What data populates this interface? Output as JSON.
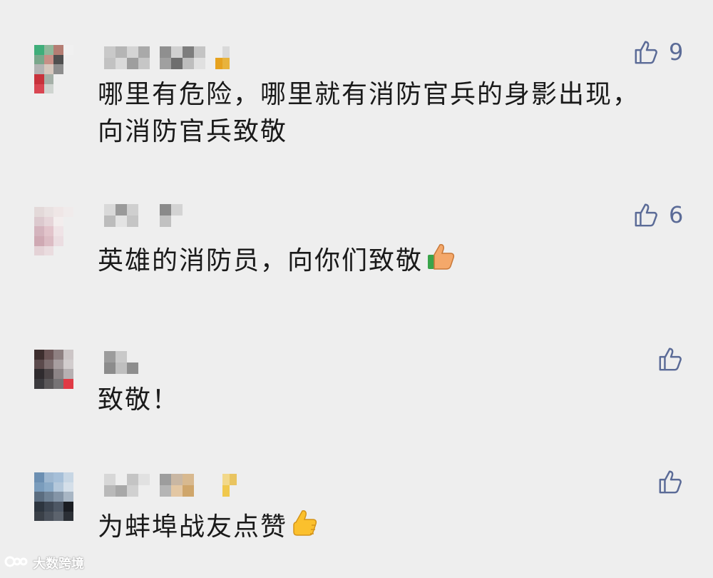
{
  "comments": [
    {
      "text_line1": "哪里有危险，哪里就有消防官兵的身影出现，",
      "text_line2": "向消防官兵致敬",
      "likes": "9",
      "avatar_colors": [
        "#3fae7a",
        "#8fb79a",
        "#b47d73",
        "#f0f0f0",
        "#eeeeee",
        "#eeeeee",
        "#7aa78b",
        "#c88f86",
        "#4f4f4f",
        "#eeeeee",
        "#eeeeee",
        "#eeeeee",
        "#b3b3b3",
        "#d6c7bd",
        "#8d8d8d",
        "#eeeeee",
        "#eeeeee",
        "#eeeeee",
        "#c8323b",
        "#a5b0a8",
        "#eeeeee",
        "#eeeeee",
        "#eeeeee",
        "#eeeeee",
        "#d94652",
        "#cfd4d0",
        "#eeeeee",
        "#eeeeee",
        "#eeeeee",
        "#eeeeee",
        "#eeeeee",
        "#eeeeee",
        "#eeeeee",
        "#eeeeee",
        "#eeeeee",
        "#eeeeee"
      ],
      "nick_colors": [
        "#c9c9c9",
        "#b5b5b5",
        "#d4d4d4",
        "#a9a9a9",
        "#c2c2c2",
        "#dadada",
        "#9e9e9e",
        "#c6c6c6"
      ],
      "nick_colors2": [
        "#8f8f8f",
        "#d0d0d0",
        "#7d7d7d",
        "#c4c4c4",
        "#a0a0a0",
        "#6e6e6e",
        "#bdbdbd",
        "#e0e0e0"
      ],
      "nick_colors3": [
        "#eeeeee",
        "#d9d9d9",
        "#eeeeee",
        "#eeeeee",
        "#e6a21f",
        "#e8b33c",
        "#eeeeee",
        "#eeeeee"
      ]
    },
    {
      "text": "英雄的消防员，向你们致敬",
      "likes": "6",
      "avatar_colors": [
        "#e3d9d9",
        "#e9e1e1",
        "#efe6e6",
        "#f0ebeb",
        "#eeeeee",
        "#eeeeee",
        "#dcc9ce",
        "#e6d5d9",
        "#f3eded",
        "#eeeeee",
        "#eeeeee",
        "#eeeeee",
        "#d4b4bd",
        "#e2c4cb",
        "#efe3e6",
        "#eeeeee",
        "#eeeeee",
        "#eeeeee",
        "#cfa9b3",
        "#dcbcc4",
        "#ebdde1",
        "#eeeeee",
        "#eeeeee",
        "#eeeeee",
        "#e4d2d6",
        "#eadcdf",
        "#eeeeee",
        "#eeeeee",
        "#eeeeee",
        "#eeeeee",
        "#eeeeee",
        "#eeeeee",
        "#eeeeee",
        "#eeeeee",
        "#eeeeee",
        "#eeeeee"
      ],
      "nick_colors": [
        "#d9d9d9",
        "#9a9a9a",
        "#cfcfcf",
        "#eeeeee",
        "#bcbcbc",
        "#e3e3e3",
        "#c5c5c5",
        "#eeeeee"
      ],
      "nick_colors2": [
        "#8a8a8a",
        "#d3d3d3",
        "#eeeeee",
        "#eeeeee",
        "#c1c1c1",
        "#eeeeee",
        "#eeeeee",
        "#eeeeee"
      ]
    },
    {
      "text": "致敬！",
      "avatar_colors": [
        "#3d2e2e",
        "#6b5556",
        "#8e8081",
        "#ccc5c6",
        "#eeeeee",
        "#eeeeee",
        "#5b4a4c",
        "#7d6e70",
        "#a79ea0",
        "#d2cdce",
        "#eeeeee",
        "#eeeeee",
        "#2f2b2e",
        "#4c4547",
        "#8c8486",
        "#b6b0b2",
        "#eeeeee",
        "#eeeeee",
        "#3b3a3e",
        "#5a5759",
        "#767375",
        "#e03a45",
        "#eeeeee",
        "#eeeeee",
        "#eeeeee",
        "#eeeeee",
        "#eeeeee",
        "#eeeeee",
        "#eeeeee",
        "#eeeeee",
        "#eeeeee",
        "#eeeeee",
        "#eeeeee",
        "#eeeeee",
        "#eeeeee",
        "#eeeeee"
      ],
      "nick_colors": [
        "#9c9c9c",
        "#c9c9c9",
        "#eeeeee",
        "#eeeeee",
        "#8c8c8c",
        "#bfbfbf",
        "#8e8e8e",
        "#eeeeee"
      ]
    },
    {
      "text": "为蚌埠战友点赞",
      "avatar_colors": [
        "#6c8fb2",
        "#9eb7d0",
        "#a6bfd8",
        "#c7d6e4",
        "#eeeeee",
        "#eeeeee",
        "#7a9cbc",
        "#8aaac7",
        "#b4c8db",
        "#d4dfe9",
        "#eeeeee",
        "#eeeeee",
        "#5b6d80",
        "#6f8295",
        "#8495a7",
        "#a8b6c4",
        "#eeeeee",
        "#eeeeee",
        "#2d353f",
        "#3d4652",
        "#4d5764",
        "#1a1d22",
        "#eeeeee",
        "#eeeeee",
        "#3a4048",
        "#4a515b",
        "#5c636d",
        "#2b2f35",
        "#eeeeee",
        "#eeeeee",
        "#eeeeee",
        "#eeeeee",
        "#eeeeee",
        "#eeeeee",
        "#eeeeee",
        "#eeeeee"
      ],
      "nick_colors": [
        "#d7d7d7",
        "#eeeeee",
        "#c4c4c4",
        "#e1e1e1",
        "#b9b9b9",
        "#a8a8a8",
        "#d0d0d0",
        "#eeeeee"
      ],
      "nick_colors2": [
        "#9d9d9d",
        "#c9b7a3",
        "#d8b98f",
        "#eeeeee",
        "#b5b5b5",
        "#e3c7a3",
        "#cfa66b",
        "#eeeeee"
      ],
      "nick_colors3": [
        "#eeeeee",
        "#f2d88a",
        "#e9c460",
        "#eeeeee",
        "#eeeeee",
        "#f0c84d",
        "#eeeeee",
        "#eeeeee"
      ]
    }
  ],
  "icons": {
    "like": "thumbs-up-outline-icon",
    "emoji": "thumbs-up-emoji-icon",
    "watermark": "logo-icon"
  },
  "colors": {
    "like_icon": "#5b6b97",
    "text": "#1a1a1a",
    "background": "#eeeeee"
  },
  "watermark": {
    "text": "大数跨境"
  }
}
